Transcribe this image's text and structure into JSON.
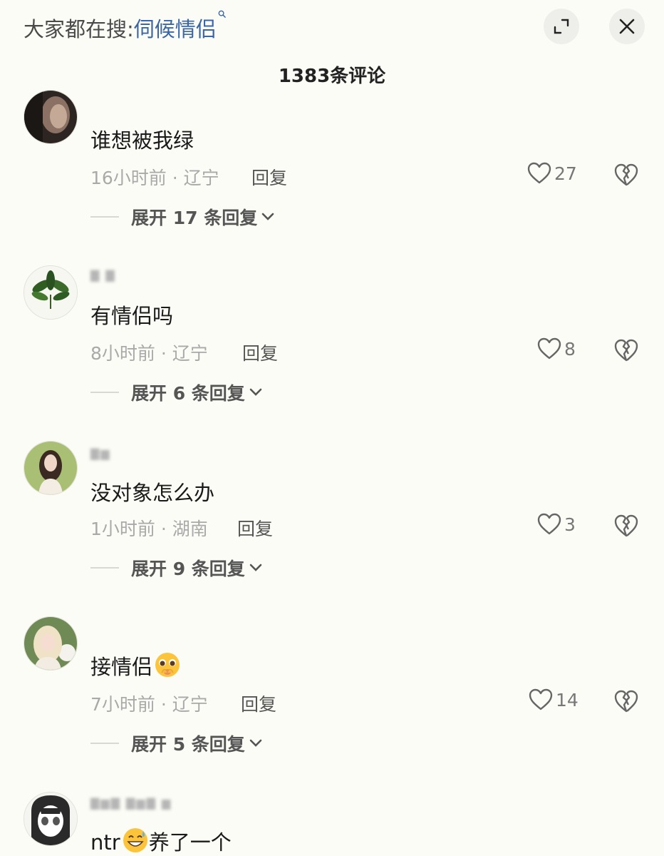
{
  "header": {
    "search_prefix": "大家都在搜:",
    "search_term": "伺候情侣",
    "comment_count_title": "1383条评论"
  },
  "icons": {
    "search": "search-icon",
    "expand": "expand-icon",
    "close": "close-icon",
    "like": "heart-icon",
    "dislike": "broken-heart-icon",
    "chevron": "chevron-down-icon"
  },
  "comments": [
    {
      "text": "谁想被我绿",
      "meta": "16小时前 · 辽宁",
      "reply_label": "回复",
      "likes": "27",
      "expand_label": "展开 17 条回复"
    },
    {
      "text": "有情侣吗",
      "meta": "8小时前 · 辽宁",
      "reply_label": "回复",
      "likes": "8",
      "expand_label": "展开 6 条回复"
    },
    {
      "text": "没对象怎么办",
      "meta": "1小时前 · 湖南",
      "reply_label": "回复",
      "likes": "3",
      "expand_label": "展开 9 条回复"
    },
    {
      "text": "接情侣",
      "meta": "7小时前 · 辽宁",
      "reply_label": "回复",
      "likes": "14",
      "expand_label": "展开 5 条回复"
    },
    {
      "text_before_emoji": "ntr",
      "text_after_emoji": "养了一个"
    }
  ],
  "colors": {
    "background": "#fcfcf7",
    "link_blue": "#3a66a6",
    "muted_gray": "#a9a9a9"
  }
}
